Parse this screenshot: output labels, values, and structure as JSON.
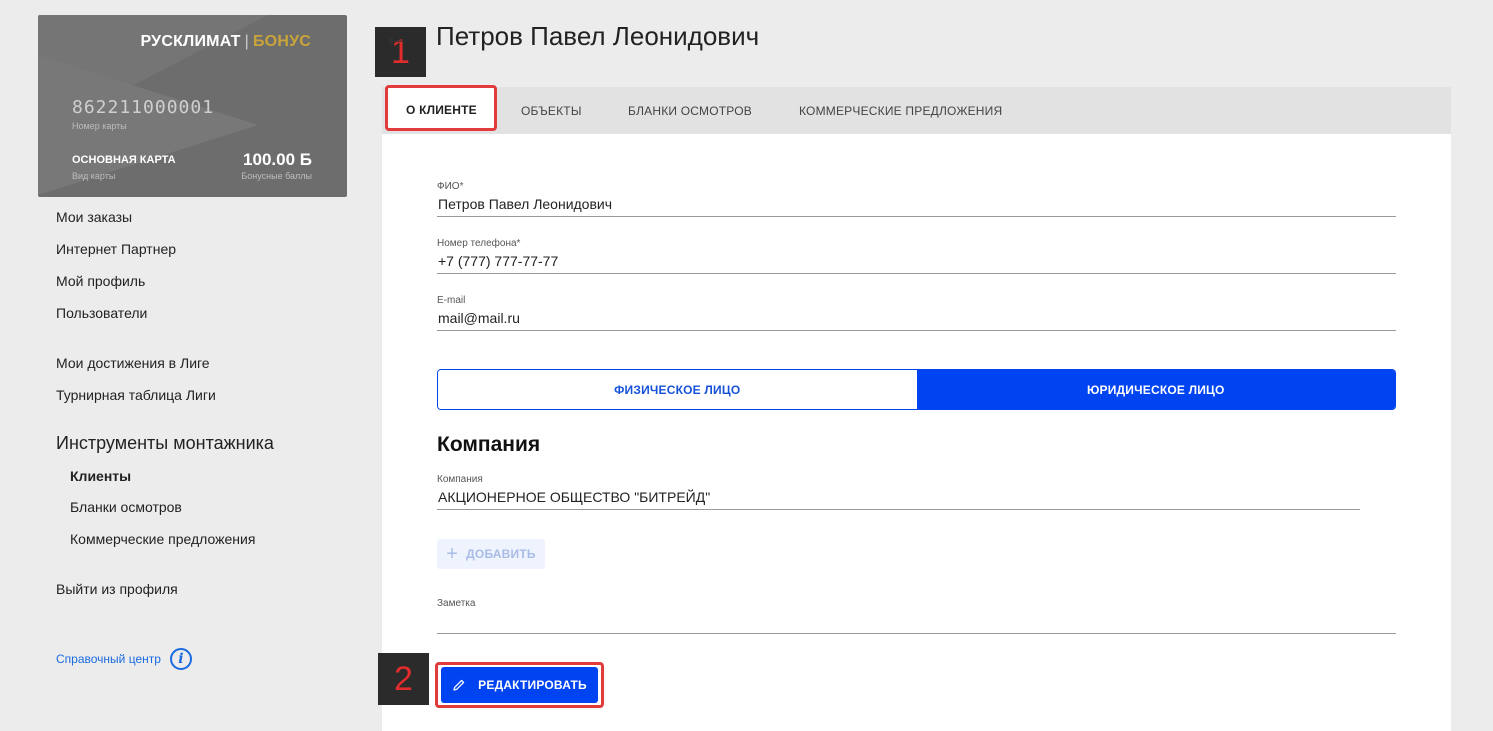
{
  "card": {
    "brand_main": "РУСКЛИМАТ",
    "brand_sep": "|",
    "brand_bonus": "БОНУС",
    "number": "862211000001",
    "number_label": "Номер карты",
    "type": "ОСНОВНАЯ КАРТА",
    "type_label": "Вид карты",
    "points": "100.00 Б",
    "points_label": "Бонусные баллы"
  },
  "sidebar": {
    "items": [
      "Мои заказы",
      "Интернет Партнер",
      "Мой профиль",
      "Пользователи"
    ],
    "league": [
      "Мои достижения в Лиге",
      "Турнирная таблица Лиги"
    ],
    "tools_heading": "Инструменты монтажника",
    "tools": [
      "Клиенты",
      "Бланки осмотров",
      "Коммерческие предложения"
    ],
    "logout": "Выйти из профиля",
    "help": "Справочный центр"
  },
  "header": {
    "back_icon": "←",
    "title": "Петров Павел Леонидович",
    "badge1": "1",
    "badge2": "2"
  },
  "tabs": [
    "О КЛИЕНТЕ",
    "ОБЪЕКТЫ",
    "БЛАНКИ ОСМОТРОВ",
    "КОММЕРЧЕСКИЕ ПРЕДЛОЖЕНИЯ"
  ],
  "form": {
    "fio_label": "ФИО*",
    "fio_value": "Петров Павел Леонидович",
    "phone_label": "Номер телефона*",
    "phone_value": "+7 (777) 777-77-77",
    "email_label": "E-mail",
    "email_value": "mail@mail.ru",
    "toggle_individual": "ФИЗИЧЕСКОЕ ЛИЦО",
    "toggle_legal": "ЮРИДИЧЕСКОЕ ЛИЦО",
    "company_heading": "Компания",
    "company_label": "Компания",
    "company_value": "АКЦИОНЕРНОЕ ОБЩЕСТВО \"БИТРЕЙД\"",
    "add_label": "ДОБАВИТЬ",
    "note_label": "Заметка",
    "edit_label": "РЕДАКТИРОВАТЬ"
  },
  "colors": {
    "accent": "#0043f0",
    "highlight": "#e23b3b",
    "bonus_gold": "#c9a43a"
  }
}
